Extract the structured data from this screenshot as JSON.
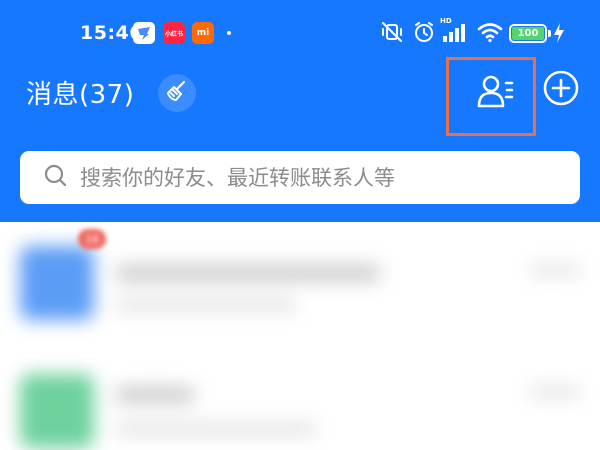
{
  "status_bar": {
    "time": "15:46",
    "apps": [
      {
        "name": "dingtalk-icon",
        "color": "#4a8cf5"
      },
      {
        "name": "xiaohongshu-icon",
        "label": "小红书",
        "color": "#ff2442"
      },
      {
        "name": "mi-icon",
        "label": "mi",
        "color": "#ff6a00"
      }
    ],
    "network_label": "HD",
    "battery": "100"
  },
  "header": {
    "title": "消息(37)",
    "accent": "#1677ff"
  },
  "search": {
    "placeholder": "搜索你的好友、最近转账联系人等"
  },
  "list": {
    "badge": "18"
  },
  "colors": {
    "highlight": "#e8714c",
    "battery": "#52d86a"
  }
}
